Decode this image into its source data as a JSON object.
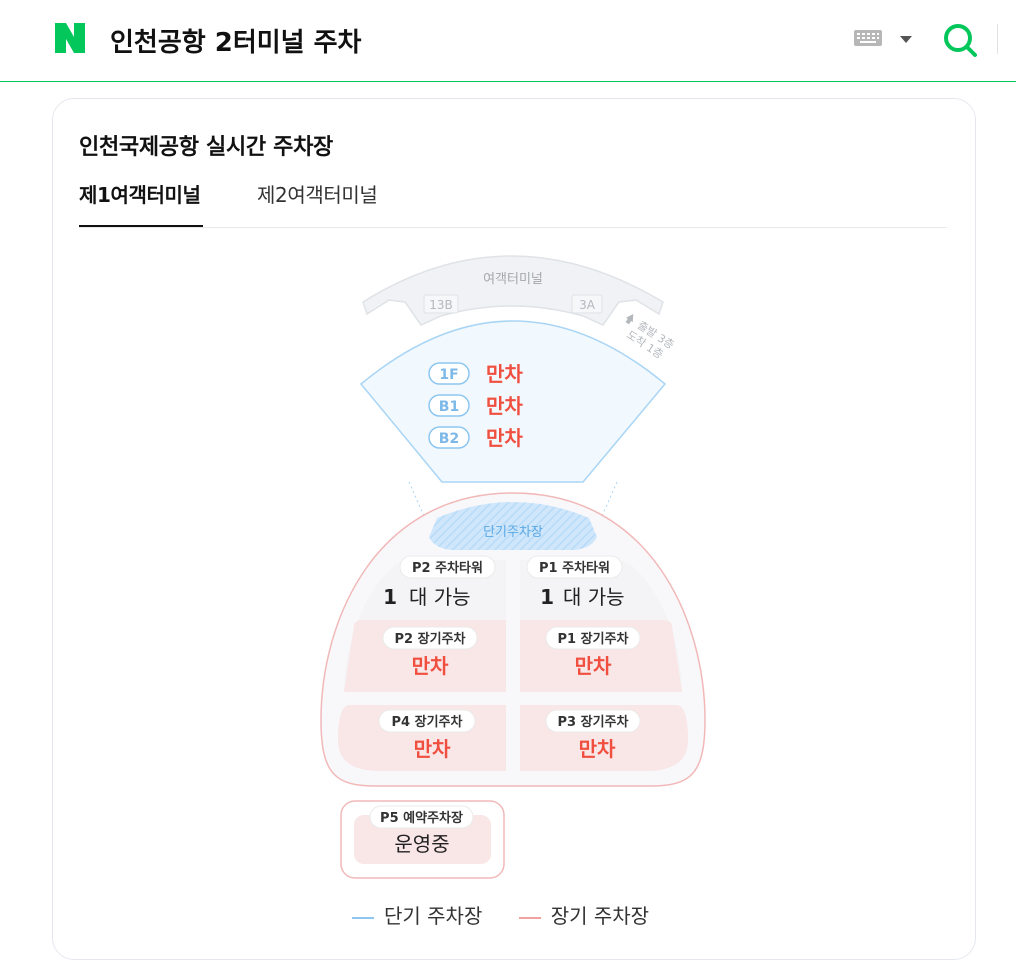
{
  "header": {
    "query": "인천공항 2터미널 주차"
  },
  "card": {
    "title": "인천국제공항 실시간 주차장",
    "tabs": [
      {
        "label": "제1여객터미널",
        "selected": true
      },
      {
        "label": "제2여객터미널",
        "selected": false
      }
    ]
  },
  "map": {
    "terminal_label": "여객터미널",
    "gate_left": "13B",
    "gate_right": "3A",
    "exit_note_line1": "출발 3층",
    "exit_note_line2": "도착 1층",
    "short_term_area": "단기주차장",
    "short_term_floors": [
      {
        "floor": "1F",
        "status": "만차"
      },
      {
        "floor": "B1",
        "status": "만차"
      },
      {
        "floor": "B2",
        "status": "만차"
      }
    ],
    "lots": {
      "p2_tower": {
        "name": "P2 주차타워",
        "count": "1",
        "unit": "대 가능"
      },
      "p1_tower": {
        "name": "P1 주차타워",
        "count": "1",
        "unit": "대 가능"
      },
      "p2_long": {
        "name": "P2 장기주차",
        "status": "만차"
      },
      "p1_long": {
        "name": "P1 장기주차",
        "status": "만차"
      },
      "p4_long": {
        "name": "P4 장기주차",
        "status": "만차"
      },
      "p3_long": {
        "name": "P3 장기주차",
        "status": "만차"
      },
      "p5_reserve": {
        "name": "P5 예약주차장",
        "status": "운영중"
      }
    }
  },
  "legend": {
    "short_term": "단기 주차장",
    "long_term": "장기 주차장"
  },
  "colors": {
    "brand_green": "#03c75a",
    "full_red": "#f04e3e",
    "short_term_blue": "#8ec6f0",
    "long_term_pink": "#f1b6b6"
  },
  "icons": [
    "naver-logo-icon",
    "keyboard-icon",
    "dropdown-arrow-icon",
    "search-icon",
    "up-arrow-icon"
  ]
}
